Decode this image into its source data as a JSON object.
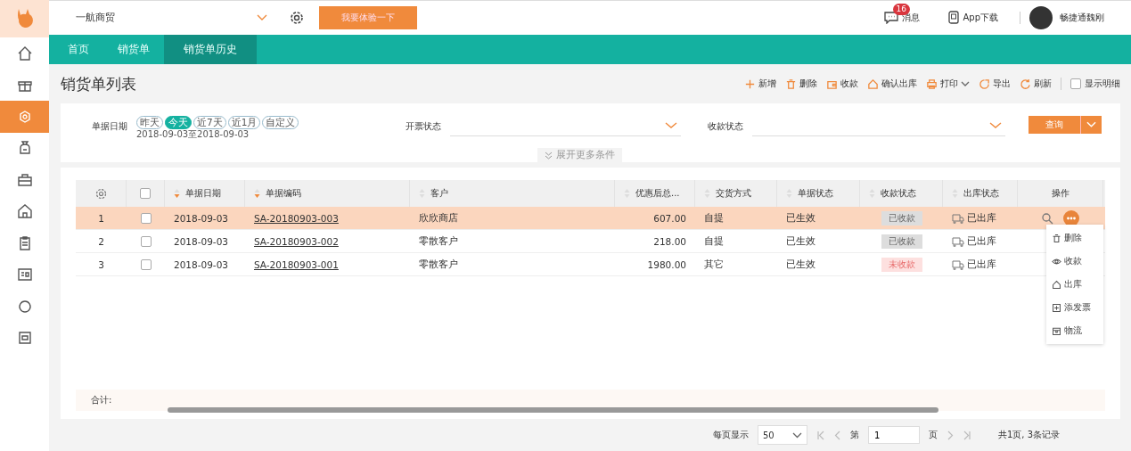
{
  "header": {
    "company": "一航商贸",
    "trial_button": "我要体验一下",
    "messages": {
      "label": "消息",
      "badge": "16"
    },
    "app_download": "App下载",
    "user": "畅捷通魏刚"
  },
  "sidebar": {
    "items": [
      {
        "selected": false
      },
      {
        "selected": false
      },
      {
        "selected": true
      },
      {
        "selected": false
      },
      {
        "selected": false
      },
      {
        "selected": false
      },
      {
        "selected": false
      },
      {
        "selected": false
      },
      {
        "selected": false
      },
      {
        "selected": false
      }
    ]
  },
  "tabs": [
    {
      "label": "首页",
      "selected": false
    },
    {
      "label": "销货单",
      "selected": false
    },
    {
      "label": "销货单历史",
      "selected": true
    }
  ],
  "page_title": "销货单列表",
  "toolbar": {
    "actions": [
      {
        "label": "新增",
        "caret": false
      },
      {
        "label": "删除",
        "caret": false
      },
      {
        "label": "收款",
        "caret": false
      },
      {
        "label": "确认出库",
        "caret": false
      },
      {
        "label": "打印",
        "caret": true
      },
      {
        "label": "导出",
        "caret": false
      },
      {
        "label": "刷新",
        "caret": false
      }
    ],
    "show_detail": {
      "label": "显示明细",
      "checked": false
    }
  },
  "filters": {
    "date_label": "单据日期",
    "quick_ranges": [
      {
        "label": "昨天",
        "selected": false
      },
      {
        "label": "今天",
        "selected": true
      },
      {
        "label": "近7天",
        "selected": false
      },
      {
        "label": "近1月",
        "selected": false
      },
      {
        "label": "自定义",
        "selected": false
      }
    ],
    "date_range": "2018-09-03至2018-09-03",
    "invoice_status_label": "开票状态",
    "payment_status_label": "收款状态",
    "query_button": "查询",
    "expand": "展开更多条件"
  },
  "table": {
    "columns": [
      {
        "kind": "settings"
      },
      {
        "kind": "checkbox",
        "checked": false
      },
      {
        "kind": "text",
        "label": "单据日期",
        "sortable": true,
        "sorted": true
      },
      {
        "kind": "text",
        "label": "单据编码",
        "sortable": true,
        "sorted": true
      },
      {
        "kind": "text",
        "label": "客户",
        "sortable": true,
        "sorted": false
      },
      {
        "kind": "text",
        "label": "优惠后总...",
        "sortable": true,
        "sorted": false
      },
      {
        "kind": "text",
        "label": "交货方式",
        "sortable": true,
        "sorted": false
      },
      {
        "kind": "text",
        "label": "单据状态",
        "sortable": true,
        "sorted": false
      },
      {
        "kind": "text",
        "label": "收款状态",
        "sortable": true,
        "sorted": false
      },
      {
        "kind": "text",
        "label": "出库状态",
        "sortable": true,
        "sorted": false
      },
      {
        "kind": "text",
        "label": "操作",
        "sortable": false
      }
    ],
    "rows": [
      {
        "index": "1",
        "selected": true,
        "checked": false,
        "date": "2018-09-03",
        "code": "SA-20180903-003",
        "customer": "欣欣商店",
        "amount": "607.00",
        "delivery": "自提",
        "doc_status": "已生效",
        "payment_status": "已收款",
        "paid": true,
        "out_status": "已出库"
      },
      {
        "index": "2",
        "selected": false,
        "checked": false,
        "date": "2018-09-03",
        "code": "SA-20180903-002",
        "customer": "零散客户",
        "amount": "218.00",
        "delivery": "自提",
        "doc_status": "已生效",
        "payment_status": "已收款",
        "paid": true,
        "out_status": "已出库"
      },
      {
        "index": "3",
        "selected": false,
        "checked": false,
        "date": "2018-09-03",
        "code": "SA-20180903-001",
        "customer": "零散客户",
        "amount": "1980.00",
        "delivery": "其它",
        "doc_status": "已生效",
        "payment_status": "未收款",
        "paid": false,
        "out_status": "已出库"
      }
    ],
    "row_menu": [
      "删除",
      "收款",
      "出库",
      "添发票",
      "物流"
    ],
    "total_label": "合计:"
  },
  "pagination": {
    "per_page_label": "每页显示",
    "per_page": "50",
    "page_prefix": "第",
    "page": "1",
    "page_suffix": "页",
    "summary": "共1页, 3条记录"
  }
}
